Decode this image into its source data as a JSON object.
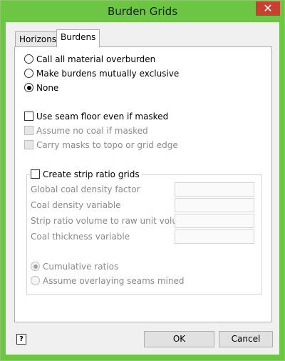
{
  "window": {
    "title": "Burden Grids",
    "close_glyph": "✕"
  },
  "tabs": [
    {
      "label": "Horizons",
      "selected": false
    },
    {
      "label": "Burdens",
      "selected": true
    }
  ],
  "burden_mode": {
    "options": [
      {
        "label": "Call all material overburden",
        "checked": false
      },
      {
        "label": "Make burdens mutually exclusive",
        "checked": false
      },
      {
        "label": "None",
        "checked": true
      }
    ]
  },
  "mask_options": [
    {
      "label": "Use seam floor even if masked",
      "checked": false,
      "enabled": true
    },
    {
      "label": "Assume no coal if masked",
      "checked": false,
      "enabled": false
    },
    {
      "label": "Carry masks to topo or grid edge",
      "checked": false,
      "enabled": false
    }
  ],
  "strip_ratio": {
    "label": "Create strip ratio grids",
    "checked": false,
    "fields": [
      {
        "label": "Global coal density factor",
        "value": ""
      },
      {
        "label": "Coal density variable",
        "value": ""
      },
      {
        "label": "Strip ratio volume to raw unit volume",
        "value": ""
      },
      {
        "label": "Coal thickness variable",
        "value": ""
      }
    ],
    "ratio_options": [
      {
        "label": "Cumulative ratios",
        "checked": true
      },
      {
        "label": "Assume overlaying seams mined",
        "checked": false
      }
    ]
  },
  "footer": {
    "help_glyph": "?",
    "ok_label": "OK",
    "cancel_label": "Cancel"
  },
  "colors": {
    "titlebar": "#6cc644",
    "close_button": "#c84031"
  }
}
